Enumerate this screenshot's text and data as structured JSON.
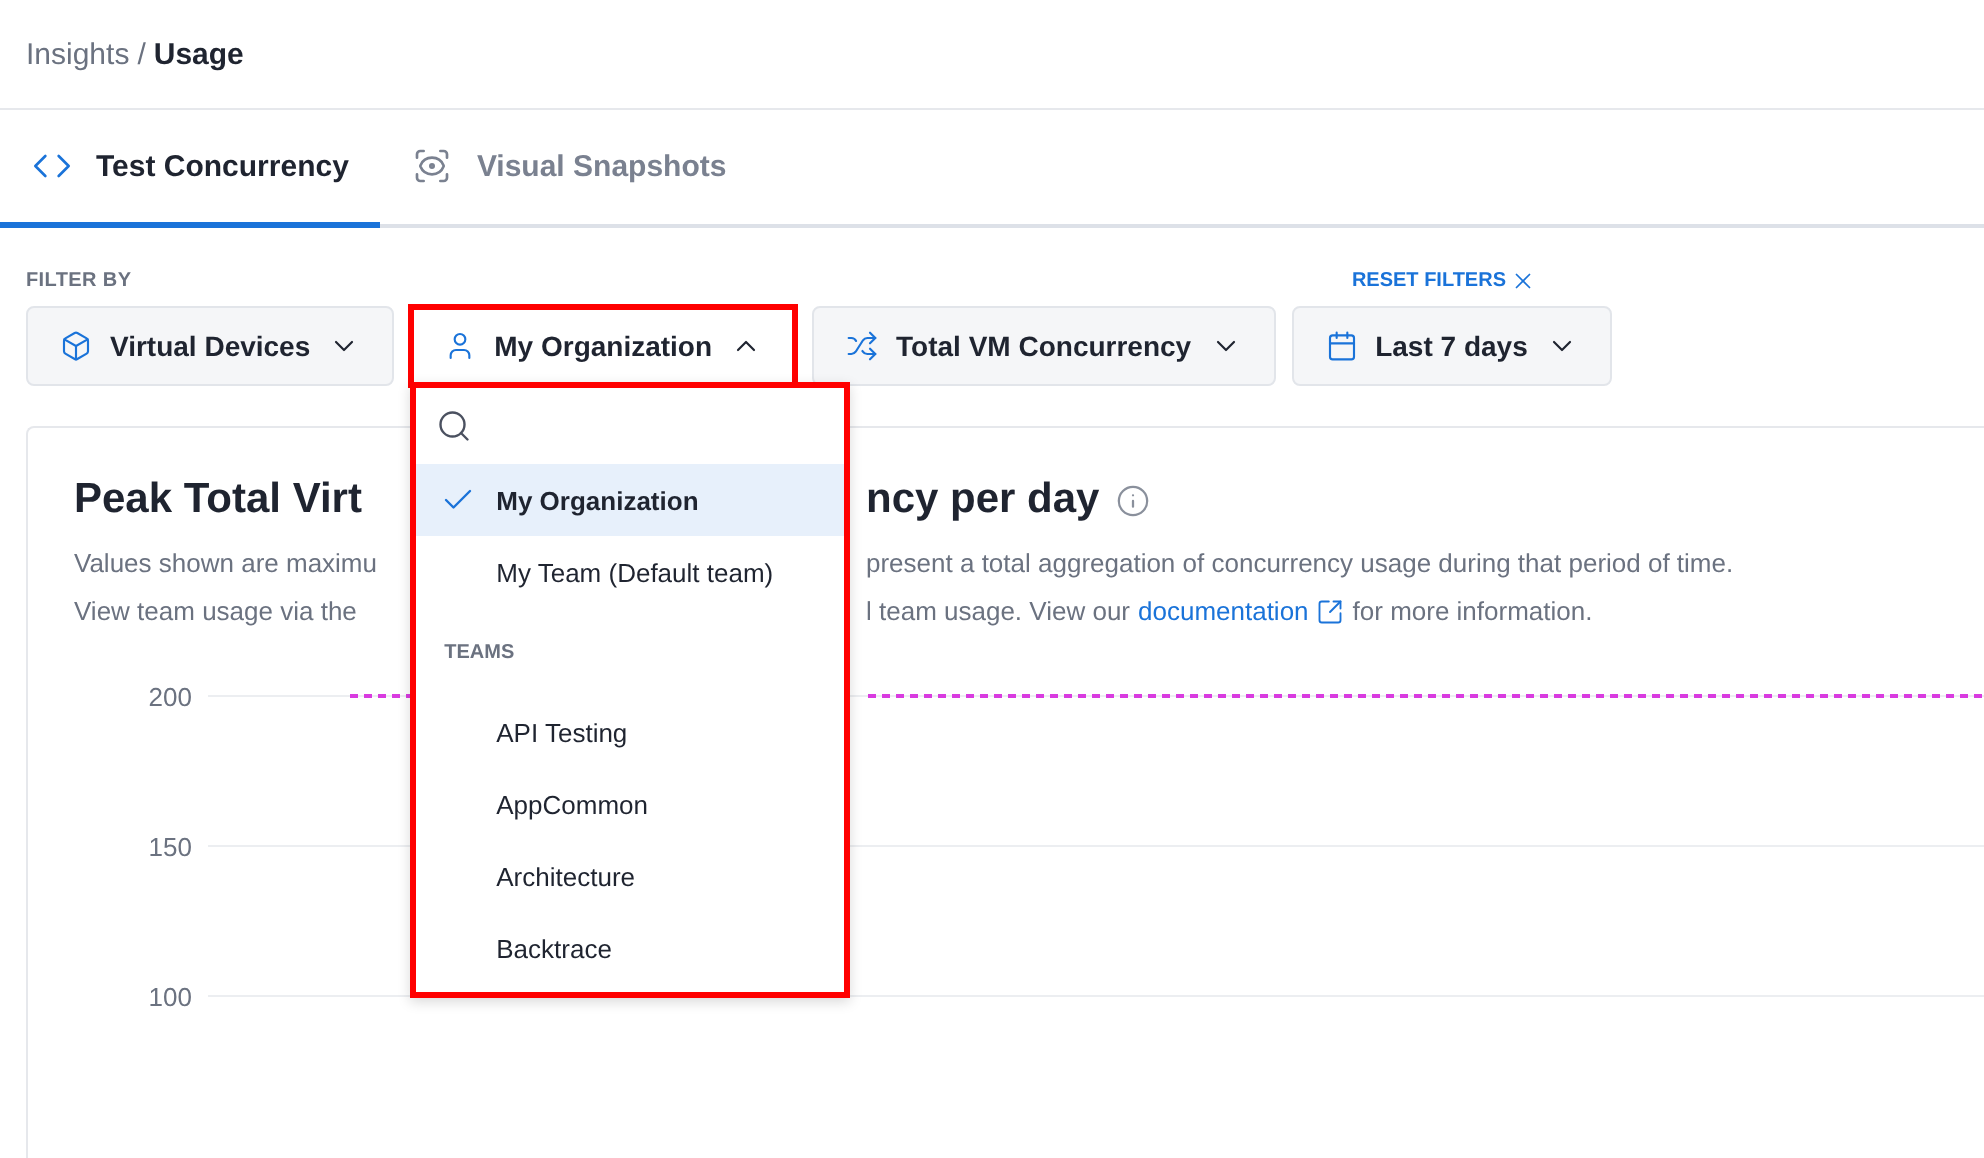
{
  "breadcrumb": {
    "items": [
      {
        "label": "Insights",
        "current": false
      },
      {
        "label": "Usage",
        "current": true
      }
    ],
    "separator": "/"
  },
  "tabs": [
    {
      "label": "Test Concurrency",
      "selected": true
    },
    {
      "label": "Visual Snapshots",
      "selected": false
    }
  ],
  "filters": {
    "label": "FILTER BY",
    "reset": "RESET FILTERS",
    "items": [
      {
        "label": "Virtual Devices",
        "expanded": false,
        "highlighted": false
      },
      {
        "label": "My Organization",
        "expanded": true,
        "highlighted": true
      },
      {
        "label": "Total VM Concurrency",
        "expanded": false,
        "highlighted": false
      },
      {
        "label": "Last 7 days",
        "expanded": false,
        "highlighted": false
      }
    ]
  },
  "menu": {
    "highlighted": true,
    "options": [
      {
        "label": "My Organization",
        "selected": true
      },
      {
        "label": "My Team (Default team)",
        "selected": false
      }
    ],
    "group": "TEAMS",
    "teams": [
      {
        "label": "API Testing",
        "selected": false
      },
      {
        "label": "AppCommon",
        "selected": false
      },
      {
        "label": "Architecture",
        "selected": false
      },
      {
        "label": "Backtrace",
        "selected": false
      }
    ]
  },
  "card": {
    "title_left": "Peak Total Virt",
    "title_right": "ncy per day",
    "description": [
      {
        "left": "Values shown are maximu",
        "right": "present a total aggregation of concurrency usage during that period of time."
      },
      {
        "left": "View team usage via the",
        "right": "l team usage. View our",
        "link": "documentation",
        "after": "for more information."
      }
    ],
    "chart": {
      "y_ticks": [
        "200",
        "150",
        "100"
      ],
      "limit_line": true
    }
  }
}
